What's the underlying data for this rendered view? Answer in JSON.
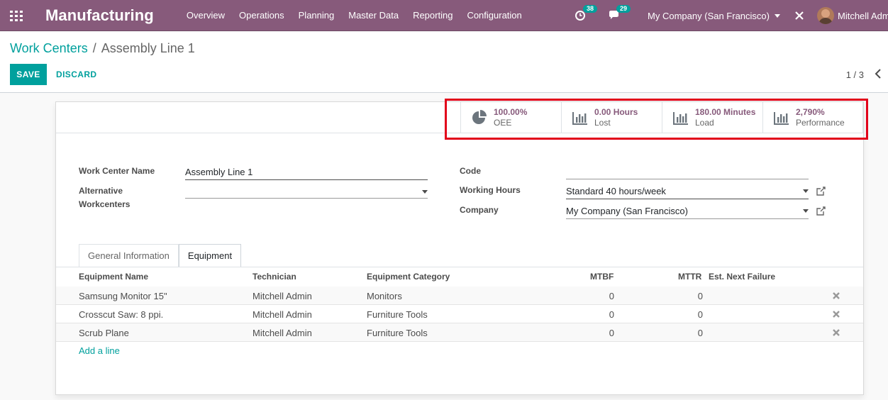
{
  "navbar": {
    "app_name": "Manufacturing",
    "menu": [
      "Overview",
      "Operations",
      "Planning",
      "Master Data",
      "Reporting",
      "Configuration"
    ],
    "activity_count": "38",
    "message_count": "29",
    "company": "My Company (San Francisco)",
    "user": "Mitchell Admin"
  },
  "breadcrumb": {
    "parent": "Work Centers",
    "separator": "/",
    "current": "Assembly Line 1"
  },
  "toolbar": {
    "save_label": "SAVE",
    "discard_label": "DISCARD",
    "pager": "1 / 3"
  },
  "stats": [
    {
      "value": "100.00%",
      "label": "OEE",
      "icon": "pie-chart-icon"
    },
    {
      "value": "0.00 Hours",
      "label": "Lost",
      "icon": "bar-chart-icon"
    },
    {
      "value": "180.00 Minutes",
      "label": "Load",
      "icon": "bar-chart-icon"
    },
    {
      "value": "2,790%",
      "label": "Performance",
      "icon": "bar-chart-icon"
    }
  ],
  "form": {
    "work_center_name_label": "Work Center Name",
    "work_center_name": "Assembly Line 1",
    "alternative_label_1": "Alternative",
    "alternative_label_2": "Workcenters",
    "alternative_value": "",
    "code_label": "Code",
    "code_value": "",
    "working_hours_label": "Working Hours",
    "working_hours": "Standard 40 hours/week",
    "company_label": "Company",
    "company": "My Company (San Francisco)"
  },
  "tabs": [
    "General Information",
    "Equipment"
  ],
  "active_tab": "Equipment",
  "table": {
    "headers": [
      "Equipment Name",
      "Technician",
      "Equipment Category",
      "MTBF",
      "MTTR",
      "Est. Next Failure"
    ],
    "rows": [
      [
        "Samsung Monitor 15\"",
        "Mitchell Admin",
        "Monitors",
        "0",
        "0",
        ""
      ],
      [
        "Crosscut Saw: 8 ppi.",
        "Mitchell Admin",
        "Furniture Tools",
        "0",
        "0",
        ""
      ],
      [
        "Scrub Plane",
        "Mitchell Admin",
        "Furniture Tools",
        "0",
        "0",
        ""
      ]
    ],
    "add_line": "Add a line"
  },
  "colors": {
    "brand": "#875a7b",
    "accent": "#00a09d",
    "highlight": "#e2001a"
  }
}
